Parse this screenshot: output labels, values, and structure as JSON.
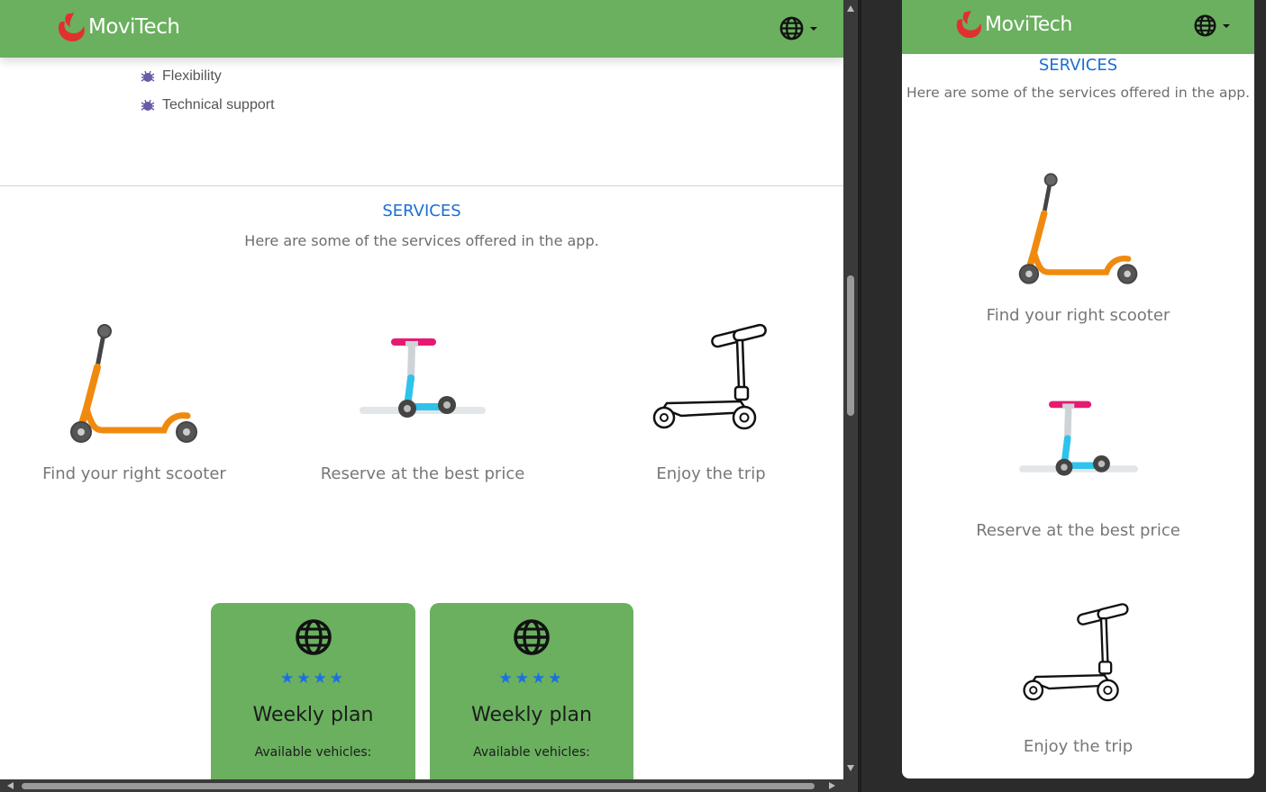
{
  "brand": {
    "name": "MoviTech",
    "logo_icon": "flame-logo-icon",
    "logo_color": "#e0312e"
  },
  "colors": {
    "nav_green": "#6ab05f",
    "accent_blue": "#1a6fd6",
    "star_blue": "#1a6fe6"
  },
  "language_menu": {
    "icon": "globe-icon"
  },
  "features": [
    {
      "icon": "bug-icon",
      "label": "Flexibility"
    },
    {
      "icon": "bug-icon",
      "label": "Technical support"
    }
  ],
  "services": {
    "title": "SERVICES",
    "subtitle": "Here are some of the services offered in the app.",
    "items": [
      {
        "icon": "orange-scooter-icon",
        "label": "Find your right scooter"
      },
      {
        "icon": "blue-scooter-icon",
        "label": "Reserve at the best price"
      },
      {
        "icon": "outline-scooter-icon",
        "label": "Enjoy the trip"
      }
    ]
  },
  "plans": [
    {
      "icon": "globe-icon",
      "stars": "★★★★",
      "rating": 4,
      "title": "Weekly plan",
      "subtitle": "Available vehicles:"
    },
    {
      "icon": "globe-icon",
      "stars": "★★★★",
      "rating": 4,
      "title": "Weekly plan",
      "subtitle": "Available vehicles:"
    }
  ]
}
